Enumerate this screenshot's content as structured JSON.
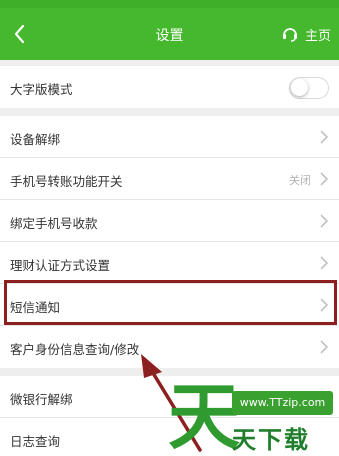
{
  "header": {
    "title": "设置",
    "home_label": "主页"
  },
  "group1": {
    "items": [
      {
        "label": "大字版模式"
      }
    ]
  },
  "group2": {
    "items": [
      {
        "label": "设备解绑"
      },
      {
        "label": "手机号转账功能开关",
        "value": "关闭"
      },
      {
        "label": "绑定手机号收款"
      },
      {
        "label": "理财认证方式设置"
      },
      {
        "label": "短信通知"
      },
      {
        "label": "客户身份信息查询/修改"
      }
    ]
  },
  "group3": {
    "items": [
      {
        "label": "微银行解绑"
      },
      {
        "label": "日志查询"
      }
    ]
  },
  "watermark": {
    "url": "www.TTzip.com",
    "text": "天下载",
    "logo": "天"
  },
  "colors": {
    "header": "#45b82d",
    "highlight": "#8c1f1f",
    "watermark": "#3aa131"
  }
}
